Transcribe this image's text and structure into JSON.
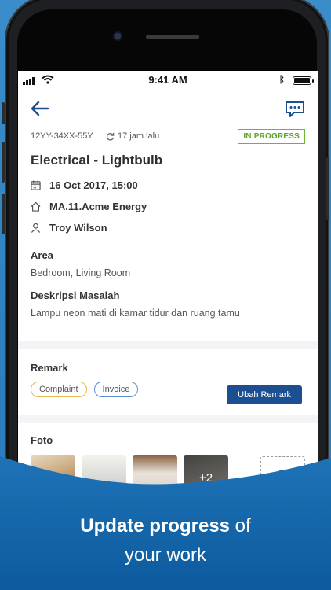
{
  "statusbar": {
    "time": "9:41 AM"
  },
  "header": {},
  "ticket": {
    "code": "12YY-34XX-55Y",
    "updated": "17 jam lalu",
    "status": "IN PROGRESS",
    "title": "Electrical - Lightbulb",
    "datetime": "16 Oct 2017, 15:00",
    "location": "MA.11.Acme Energy",
    "person": "Troy Wilson",
    "area_label": "Area",
    "area_value": "Bedroom, Living Room",
    "desc_label": "Deskripsi Masalah",
    "desc_value": "Lampu neon mati di kamar tidur dan ruang tamu"
  },
  "remark": {
    "label": "Remark",
    "chips": [
      "Complaint",
      "Invoice"
    ],
    "button": "Ubah Remark"
  },
  "foto": {
    "label": "Foto",
    "more": "+2"
  },
  "tagline": {
    "bold": "Update progress",
    "rest1": " of",
    "line2": "your work"
  },
  "colors": {
    "accent": "#1b4f91",
    "status_green": "#5da52b",
    "background": "#3b8dca"
  }
}
